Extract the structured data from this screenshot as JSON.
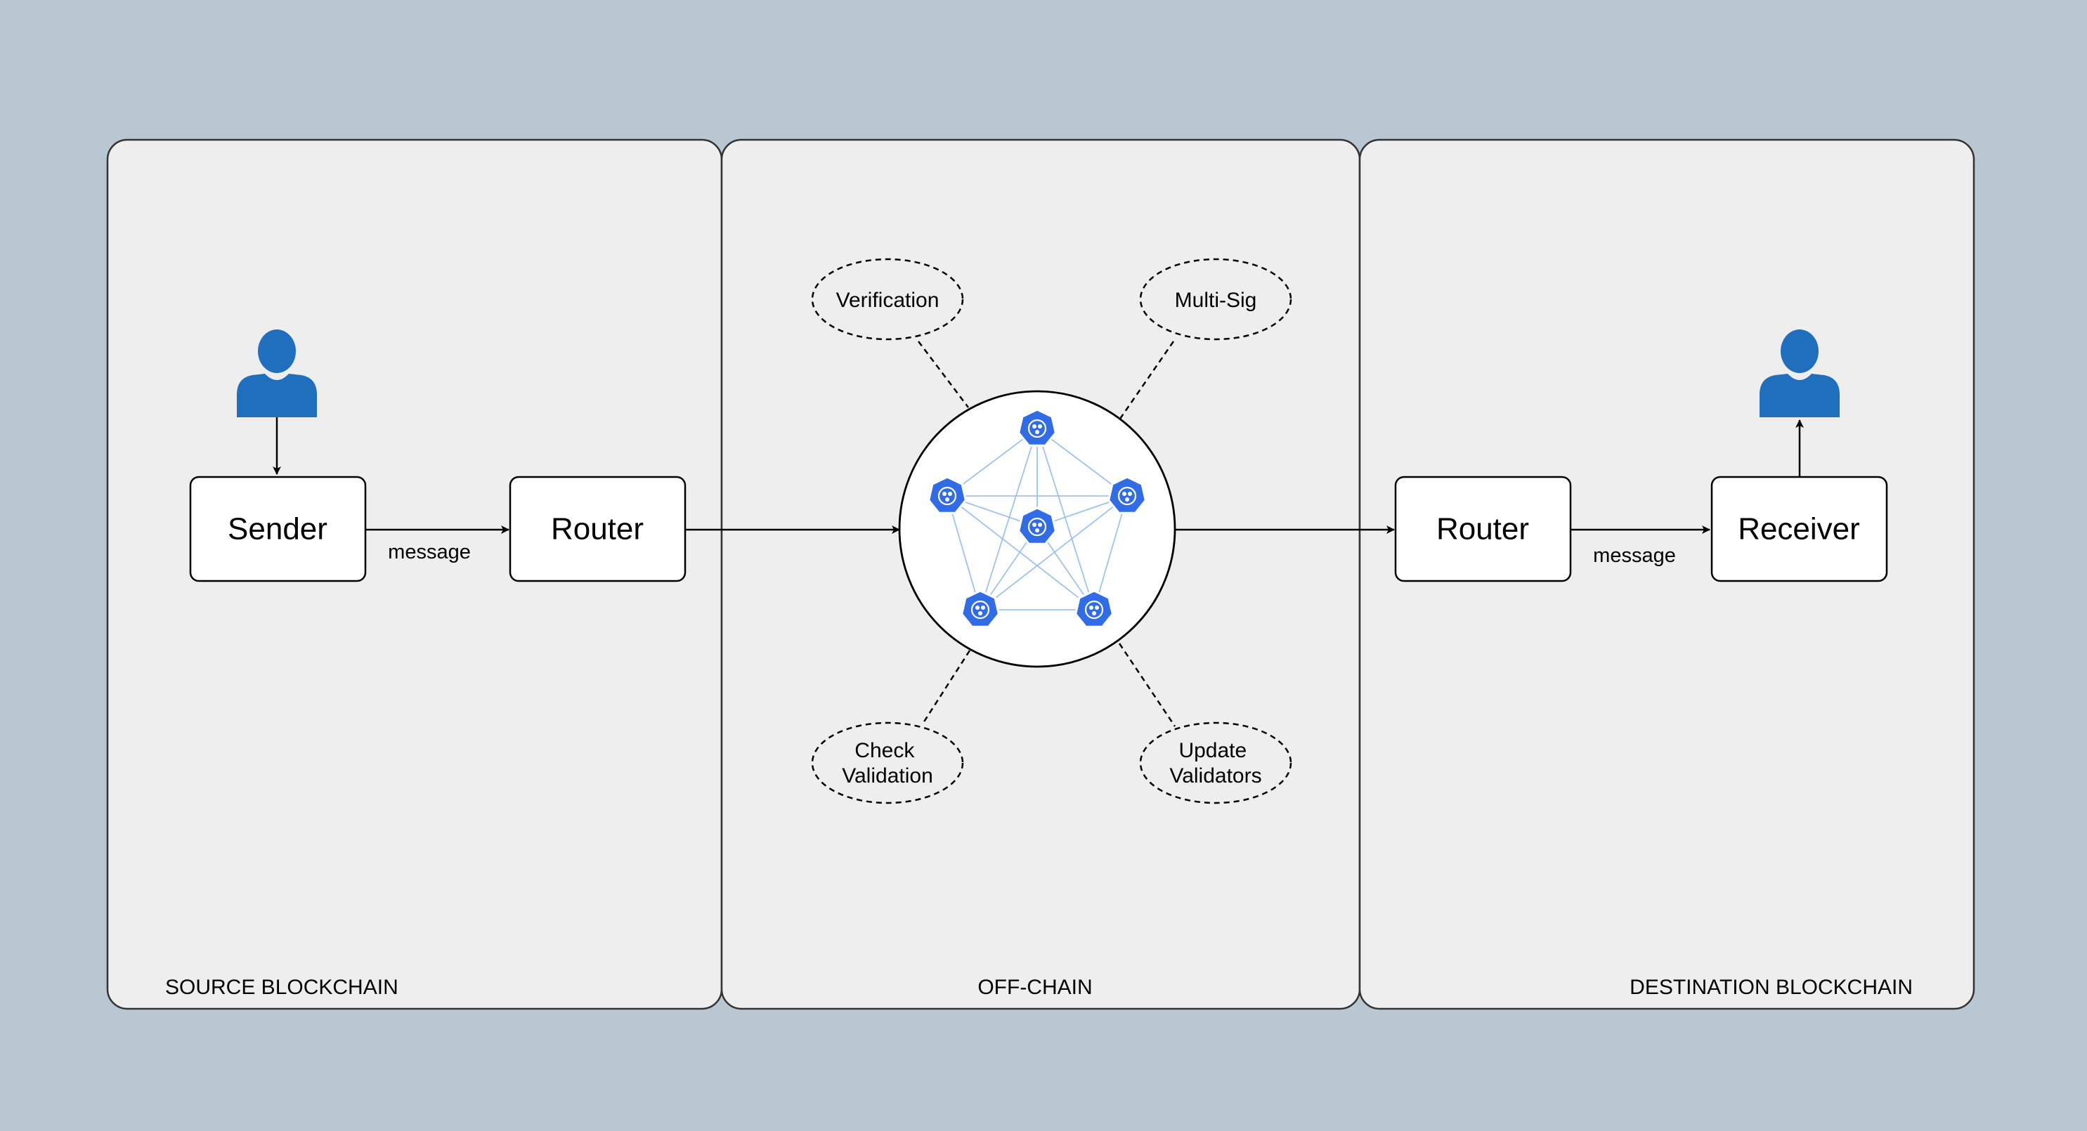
{
  "colors": {
    "background": "#b9c7d2",
    "panel": "#eeeeee",
    "user_icon": "#1f6fbd",
    "validator_node": "#326ce5",
    "mesh_line": "#9fc3ec"
  },
  "zones": {
    "source": "SOURCE BLOCKCHAIN",
    "offchain": "OFF-CHAIN",
    "destination": "DESTINATION BLOCKCHAIN"
  },
  "source": {
    "sender": "Sender",
    "router": "Router",
    "edge_label": "message"
  },
  "destination": {
    "router": "Router",
    "receiver": "Receiver",
    "edge_label": "message"
  },
  "offchain": {
    "functions": {
      "verification": {
        "lines": [
          "Verification"
        ]
      },
      "multisig": {
        "lines": [
          "Multi-Sig"
        ]
      },
      "check_validation": {
        "lines": [
          "Check",
          "Validation"
        ]
      },
      "update_validators": {
        "lines": [
          "Update",
          "Validators"
        ]
      }
    },
    "validator_network": {
      "node_icon": "kubernetes-node-icon",
      "node_count": 6
    }
  },
  "icons": {
    "sender_user": "user-icon",
    "receiver_user": "user-icon"
  }
}
